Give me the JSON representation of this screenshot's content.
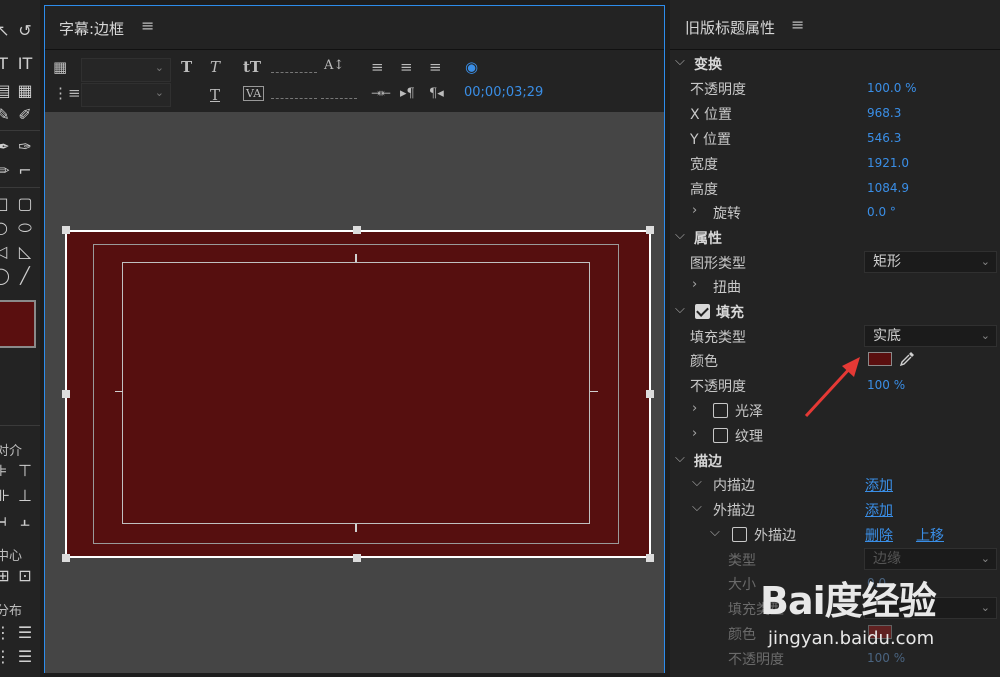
{
  "tools": {
    "labels": {
      "align": "对介",
      "center": "中心",
      "distribute": "分布"
    }
  },
  "title_panel": {
    "title": "字幕:边框",
    "menu_glyph": "≡",
    "timecode": "00;00;03;29"
  },
  "properties": {
    "title": "旧版标题属性",
    "menu_glyph": "≡",
    "transform": {
      "label": "变换",
      "opacity_label": "不透明度",
      "opacity": "100.0 %",
      "x_label": "X 位置",
      "x": "968.3",
      "y_label": "Y 位置",
      "y": "546.3",
      "width_label": "宽度",
      "width": "1921.0",
      "height_label": "高度",
      "height": "1084.9",
      "rotation_label": "旋转",
      "rotation": "0.0 °"
    },
    "attributes": {
      "label": "属性",
      "shape_label": "图形类型",
      "shape_value": "矩形",
      "distort_label": "扭曲"
    },
    "fill": {
      "label": "填充",
      "type_label": "填充类型",
      "type_value": "实底",
      "color_label": "颜色",
      "color": "#5a0f0f",
      "opacity_label": "不透明度",
      "opacity": "100 %",
      "sheen_label": "光泽",
      "texture_label": "纹理"
    },
    "strokes": {
      "label": "描边",
      "inner_label": "内描边",
      "inner_add": "添加",
      "outer_label": "外描边",
      "outer_add": "添加",
      "outer_item_label": "外描边",
      "delete": "删除",
      "move_up": "上移",
      "type_label": "类型",
      "type_value": "边缘",
      "size_label": "大小",
      "size_value": "0.0",
      "fill_type_label": "填充类型",
      "color_label": "颜色",
      "opacity_label": "不透明度",
      "opacity": "100 %"
    }
  },
  "watermark": {
    "logo": "Bai度经验",
    "url": "jingyan.baidu.com"
  },
  "colors": {
    "accent": "#2d8ceb",
    "rect_fill": "#560f0f",
    "annotation_arrow": "#e53935"
  }
}
